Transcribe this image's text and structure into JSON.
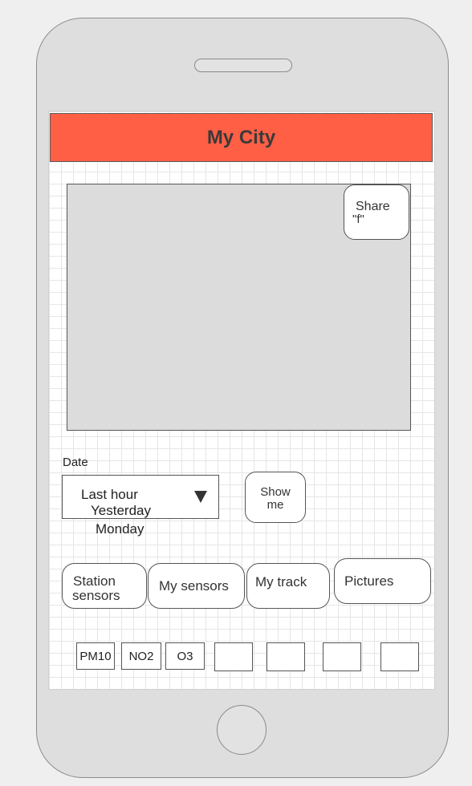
{
  "header": {
    "title": "My City"
  },
  "map": {
    "share_line1": "Share",
    "share_line2": "\"f\""
  },
  "date": {
    "label": "Date",
    "options": [
      "Last hour",
      "Yesterday",
      "Monday"
    ]
  },
  "show_button": {
    "line1": "Show",
    "line2": "me"
  },
  "tabs": {
    "station_line1": "Station",
    "station_line2": "sensors",
    "my_sensors": "My sensors",
    "my_track": "My track",
    "pictures": "Pictures"
  },
  "pollutants": [
    "PM10",
    "NO2",
    "O3"
  ],
  "colors": {
    "header": "#ff5f45",
    "map": "#dcdcdc"
  }
}
